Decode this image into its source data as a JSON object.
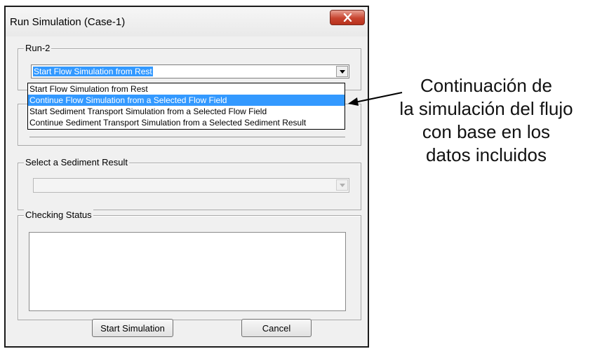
{
  "window": {
    "title": "Run Simulation (Case-1)"
  },
  "run_group": {
    "label": "Run-2",
    "selected": "Start Flow Simulation from Rest",
    "options": [
      "Start Flow Simulation from Rest",
      "Continue Flow Simulation from a Selected Flow Field",
      "Start Sediment Transport Simulation from a Selected Flow Field",
      "Continue Sediment Transport Simulation from a Selected Sediment Result"
    ],
    "highlighted_index": 1
  },
  "sediment_group": {
    "label": "Select a Sediment Result",
    "value": ""
  },
  "status_group": {
    "label": "Checking Status",
    "text": ""
  },
  "buttons": {
    "start": "Start Simulation",
    "cancel": "Cancel"
  },
  "annotation": {
    "lines": [
      "Continuación de",
      "la simulación del flujo",
      "con base en los",
      "datos incluidos"
    ]
  },
  "colors": {
    "selection": "#3399ff",
    "close_button": "#c7442f"
  },
  "icons": [
    "close-icon",
    "chevron-down-icon"
  ]
}
